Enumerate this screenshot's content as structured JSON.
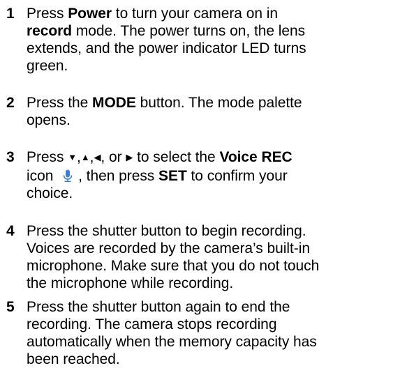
{
  "steps": [
    {
      "number": "1",
      "lines": [
        [
          "Press ",
          {
            "b": "Power"
          },
          " to turn your camera on in"
        ],
        [
          {
            "b": "record"
          },
          " mode. The power turns on, the lens"
        ],
        [
          "extends, and the power indicator LED turns"
        ],
        [
          "green."
        ]
      ]
    },
    {
      "number": "2",
      "lines": [
        [
          "Press the ",
          {
            "b": "MODE"
          },
          " button. The mode palette"
        ],
        [
          "opens."
        ]
      ]
    },
    {
      "number": "3",
      "lines": [
        [
          "Press ",
          {
            "a": "▼"
          },
          ",",
          {
            "a": "▲"
          },
          ",",
          {
            "a": "◀"
          },
          ", or ",
          {
            "a": "▶"
          },
          " to select the ",
          {
            "b": "Voice REC"
          }
        ],
        [
          "icon ",
          {
            "i": "microphone-icon"
          },
          ", then press ",
          {
            "b": "SET"
          },
          " to confirm your"
        ],
        [
          "choice."
        ]
      ]
    },
    {
      "number": "4",
      "lines": [
        [
          "Press the shutter button to begin recording."
        ],
        [
          "Voices are recorded by the camera’s built-in"
        ],
        [
          "microphone. Make sure that you do not touch"
        ],
        [
          "the microphone while recording."
        ]
      ]
    },
    {
      "number": "5",
      "lines": [
        [
          "Press the shutter button again to end the"
        ],
        [
          "recording. The camera stops recording"
        ],
        [
          "automatically when the memory capacity has"
        ],
        [
          "been reached."
        ]
      ]
    }
  ],
  "colors": {
    "text": "#000000",
    "icon": "#3d7fc9"
  }
}
